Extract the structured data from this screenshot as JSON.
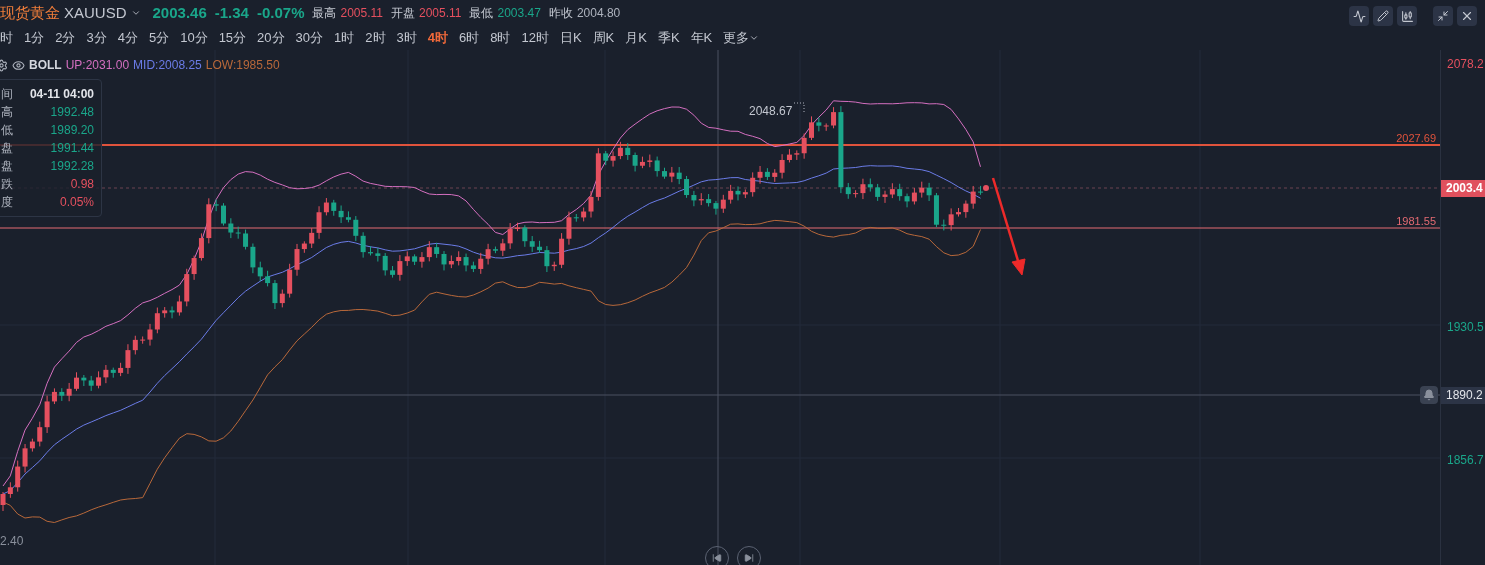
{
  "header": {
    "name": "现货黄金",
    "symbol": "XAUUSD",
    "price": "2003.46",
    "change": "-1.34",
    "change_pct": "-0.07%",
    "stats": [
      {
        "label": "最高",
        "value": "2005.11",
        "color": "#e5505f"
      },
      {
        "label": "开盘",
        "value": "2005.11",
        "color": "#e5505f"
      },
      {
        "label": "最低",
        "value": "2003.47",
        "color": "#1aa68a"
      },
      {
        "label": "昨收",
        "value": "2004.80",
        "color": "#aeb3be"
      }
    ]
  },
  "intervals": [
    {
      "label": "时",
      "selected": false
    },
    {
      "label": "1分",
      "selected": false
    },
    {
      "label": "2分",
      "selected": false
    },
    {
      "label": "3分",
      "selected": false
    },
    {
      "label": "4分",
      "selected": false
    },
    {
      "label": "5分",
      "selected": false
    },
    {
      "label": "10分",
      "selected": false
    },
    {
      "label": "15分",
      "selected": false
    },
    {
      "label": "20分",
      "selected": false
    },
    {
      "label": "30分",
      "selected": false
    },
    {
      "label": "1时",
      "selected": false
    },
    {
      "label": "2时",
      "selected": false
    },
    {
      "label": "3时",
      "selected": false
    },
    {
      "label": "4时",
      "selected": true
    },
    {
      "label": "6时",
      "selected": false
    },
    {
      "label": "8时",
      "selected": false
    },
    {
      "label": "12时",
      "selected": false
    },
    {
      "label": "日K",
      "selected": false
    },
    {
      "label": "周K",
      "selected": false
    },
    {
      "label": "月K",
      "selected": false
    },
    {
      "label": "季K",
      "selected": false
    },
    {
      "label": "年K",
      "selected": false
    }
  ],
  "more": "更多",
  "indicator": {
    "name": "BOLL",
    "up": "UP:2031.00",
    "mid": "MID:2008.25",
    "low": "LOW:1985.50"
  },
  "tooltip": [
    {
      "label": "间",
      "value": "04-11 04:00",
      "color": "#e3e5ea"
    },
    {
      "label": "高",
      "value": "1992.48",
      "color": "#1aa68a"
    },
    {
      "label": "低",
      "value": "1989.20",
      "color": "#1aa68a"
    },
    {
      "label": "盘",
      "value": "1991.44",
      "color": "#1aa68a"
    },
    {
      "label": "盘",
      "value": "1992.28",
      "color": "#1aa68a"
    },
    {
      "label": "跌",
      "value": "0.98",
      "color": "#e5505f"
    },
    {
      "label": "度",
      "value": "0.05%",
      "color": "#e5505f"
    }
  ],
  "price_lines": [
    {
      "label": "2027.69"
    },
    {
      "label": "1981.55"
    }
  ],
  "peak_label": "2048.67",
  "left_label": "2.40",
  "axis": {
    "labels": [
      "2078.2",
      "1930.5",
      "1856.7"
    ],
    "current_price": "2003.4",
    "crosshair_price": "1890.2"
  }
}
